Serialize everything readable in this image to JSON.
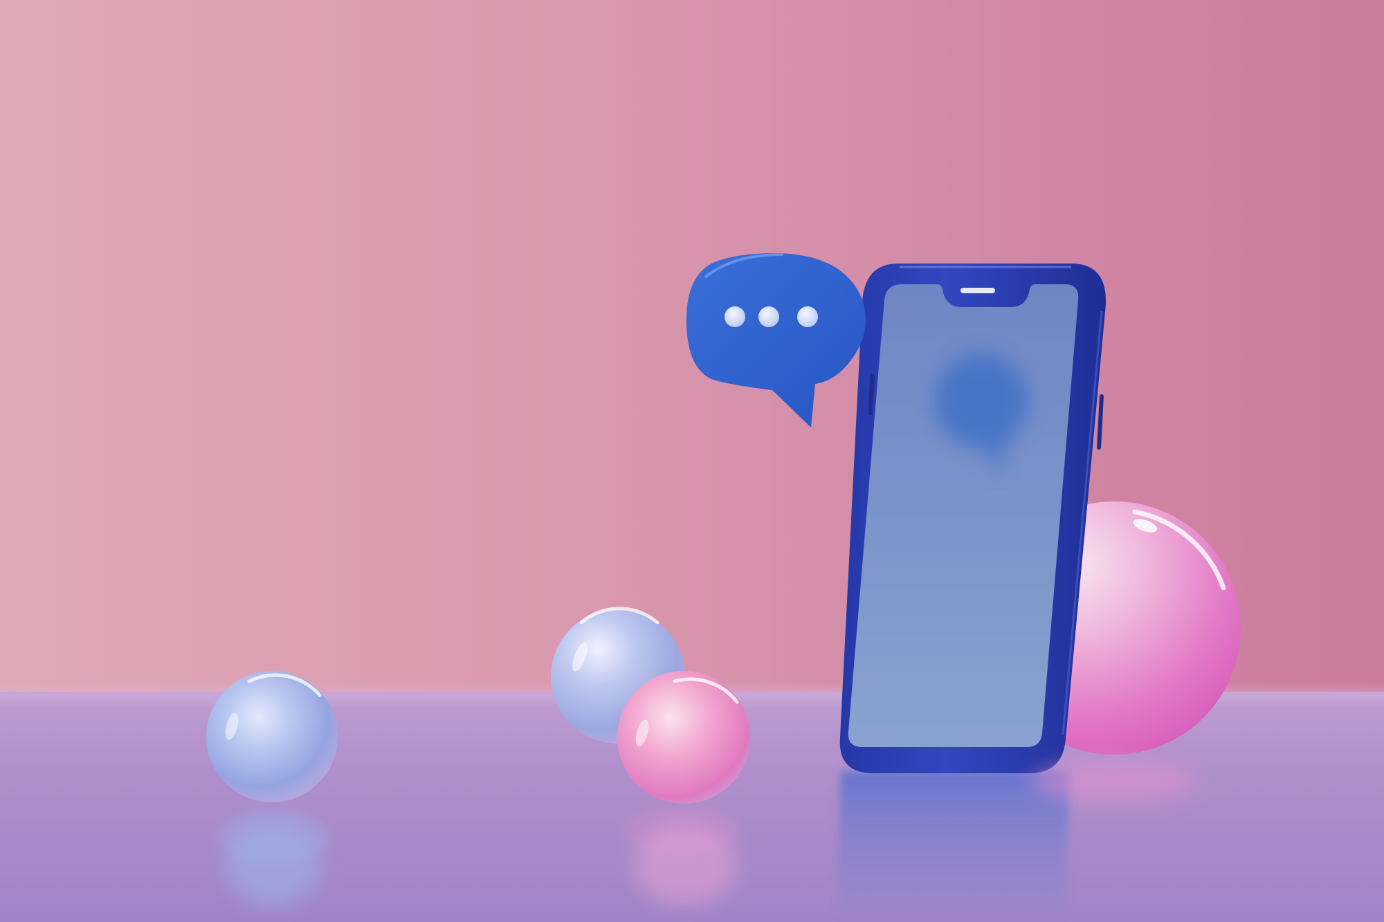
{
  "scene": {
    "subject": "smartphone-with-chat-bubble",
    "colors": {
      "wall_left": "#dfa9b7",
      "wall_right": "#cc7a9c",
      "floor": "#ae8ecb",
      "phone_frame": "#2e3fb3",
      "phone_screen": "#7a93c6",
      "chat_bubble": "#2f63cf",
      "bubble_dot": "#dbe3f5",
      "glass_sphere_blue": "#9fb4e6",
      "glass_sphere_pink": "#e98ac6"
    },
    "icons": {
      "chat_bubble": "chat-bubble-typing-icon"
    }
  }
}
